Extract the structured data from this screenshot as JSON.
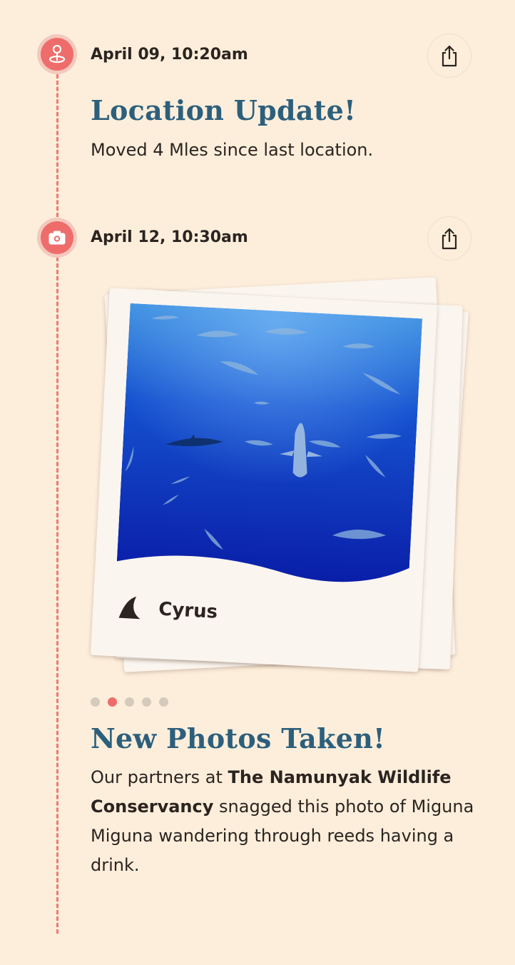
{
  "entries": [
    {
      "date": "April 09, 10:20am",
      "title": "Location Update!",
      "text": "Moved 4 Mles since last location.",
      "icon": "location-pin-icon"
    },
    {
      "date": "April 12, 10:30am",
      "title": "New Photos Taken!",
      "text_bold_1": "The Namunyak Wildlife Conservancy",
      "text_pre": "Our partners at ",
      "text_post": " snagged this photo of Miguna Miguna wandering through reeds having a drink.",
      "icon": "camera-icon",
      "photo_caption": "Cyrus",
      "photo_icon": "shark-fin-icon",
      "carousel": {
        "total": 5,
        "active_index": 1
      }
    }
  ],
  "colors": {
    "background": "#fdeedb",
    "accent": "#ee6d6b",
    "heading": "#2c5f7c",
    "text": "#2b2420"
  }
}
